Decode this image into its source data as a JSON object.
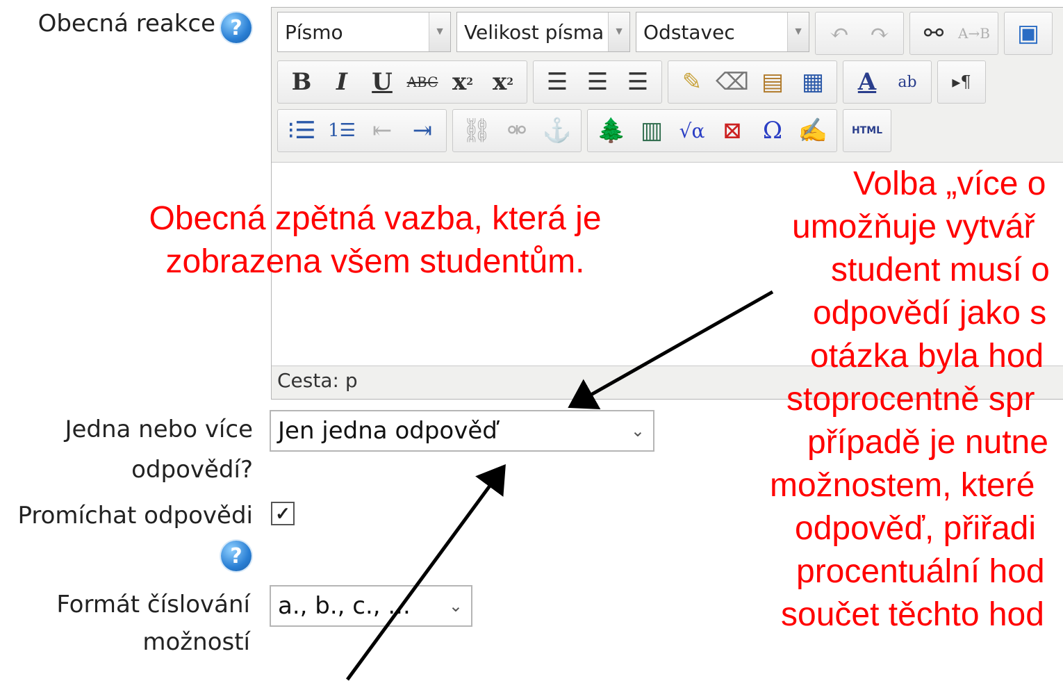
{
  "form": {
    "general_feedback_label": "Obecná reakce",
    "single_multiple_label_line1": "Jedna nebo více",
    "single_multiple_label_line2": "odpovědí?",
    "single_multiple_value": "Jen jedna odpověď",
    "shuffle_label": "Promíchat odpovědi",
    "shuffle_checked": true,
    "numbering_label_line1": "Formát číslování",
    "numbering_label_line2": "možností",
    "numbering_value": "a., b., c., ..."
  },
  "editor": {
    "font_combo": "Písmo",
    "size_combo": "Velikost písma",
    "format_combo": "Odstavec",
    "html_button": "HTML",
    "path_label": "Cesta: p"
  },
  "annotations": {
    "left_note_line1": "Obecná zpětná vazba, která je",
    "left_note_line2": "zobrazena všem studentům.",
    "right_note_lines": [
      "Volba „více o",
      "umožňuje vytvář",
      "student musí o",
      "odpovědí jako s",
      "otázka byla hod",
      "stoprocentně spr",
      "případě je nutne",
      "možnostem, které",
      "odpověď, přiřadi",
      "procentuální hod",
      "součet těchto hod"
    ],
    "text_color": "#ff0000"
  }
}
